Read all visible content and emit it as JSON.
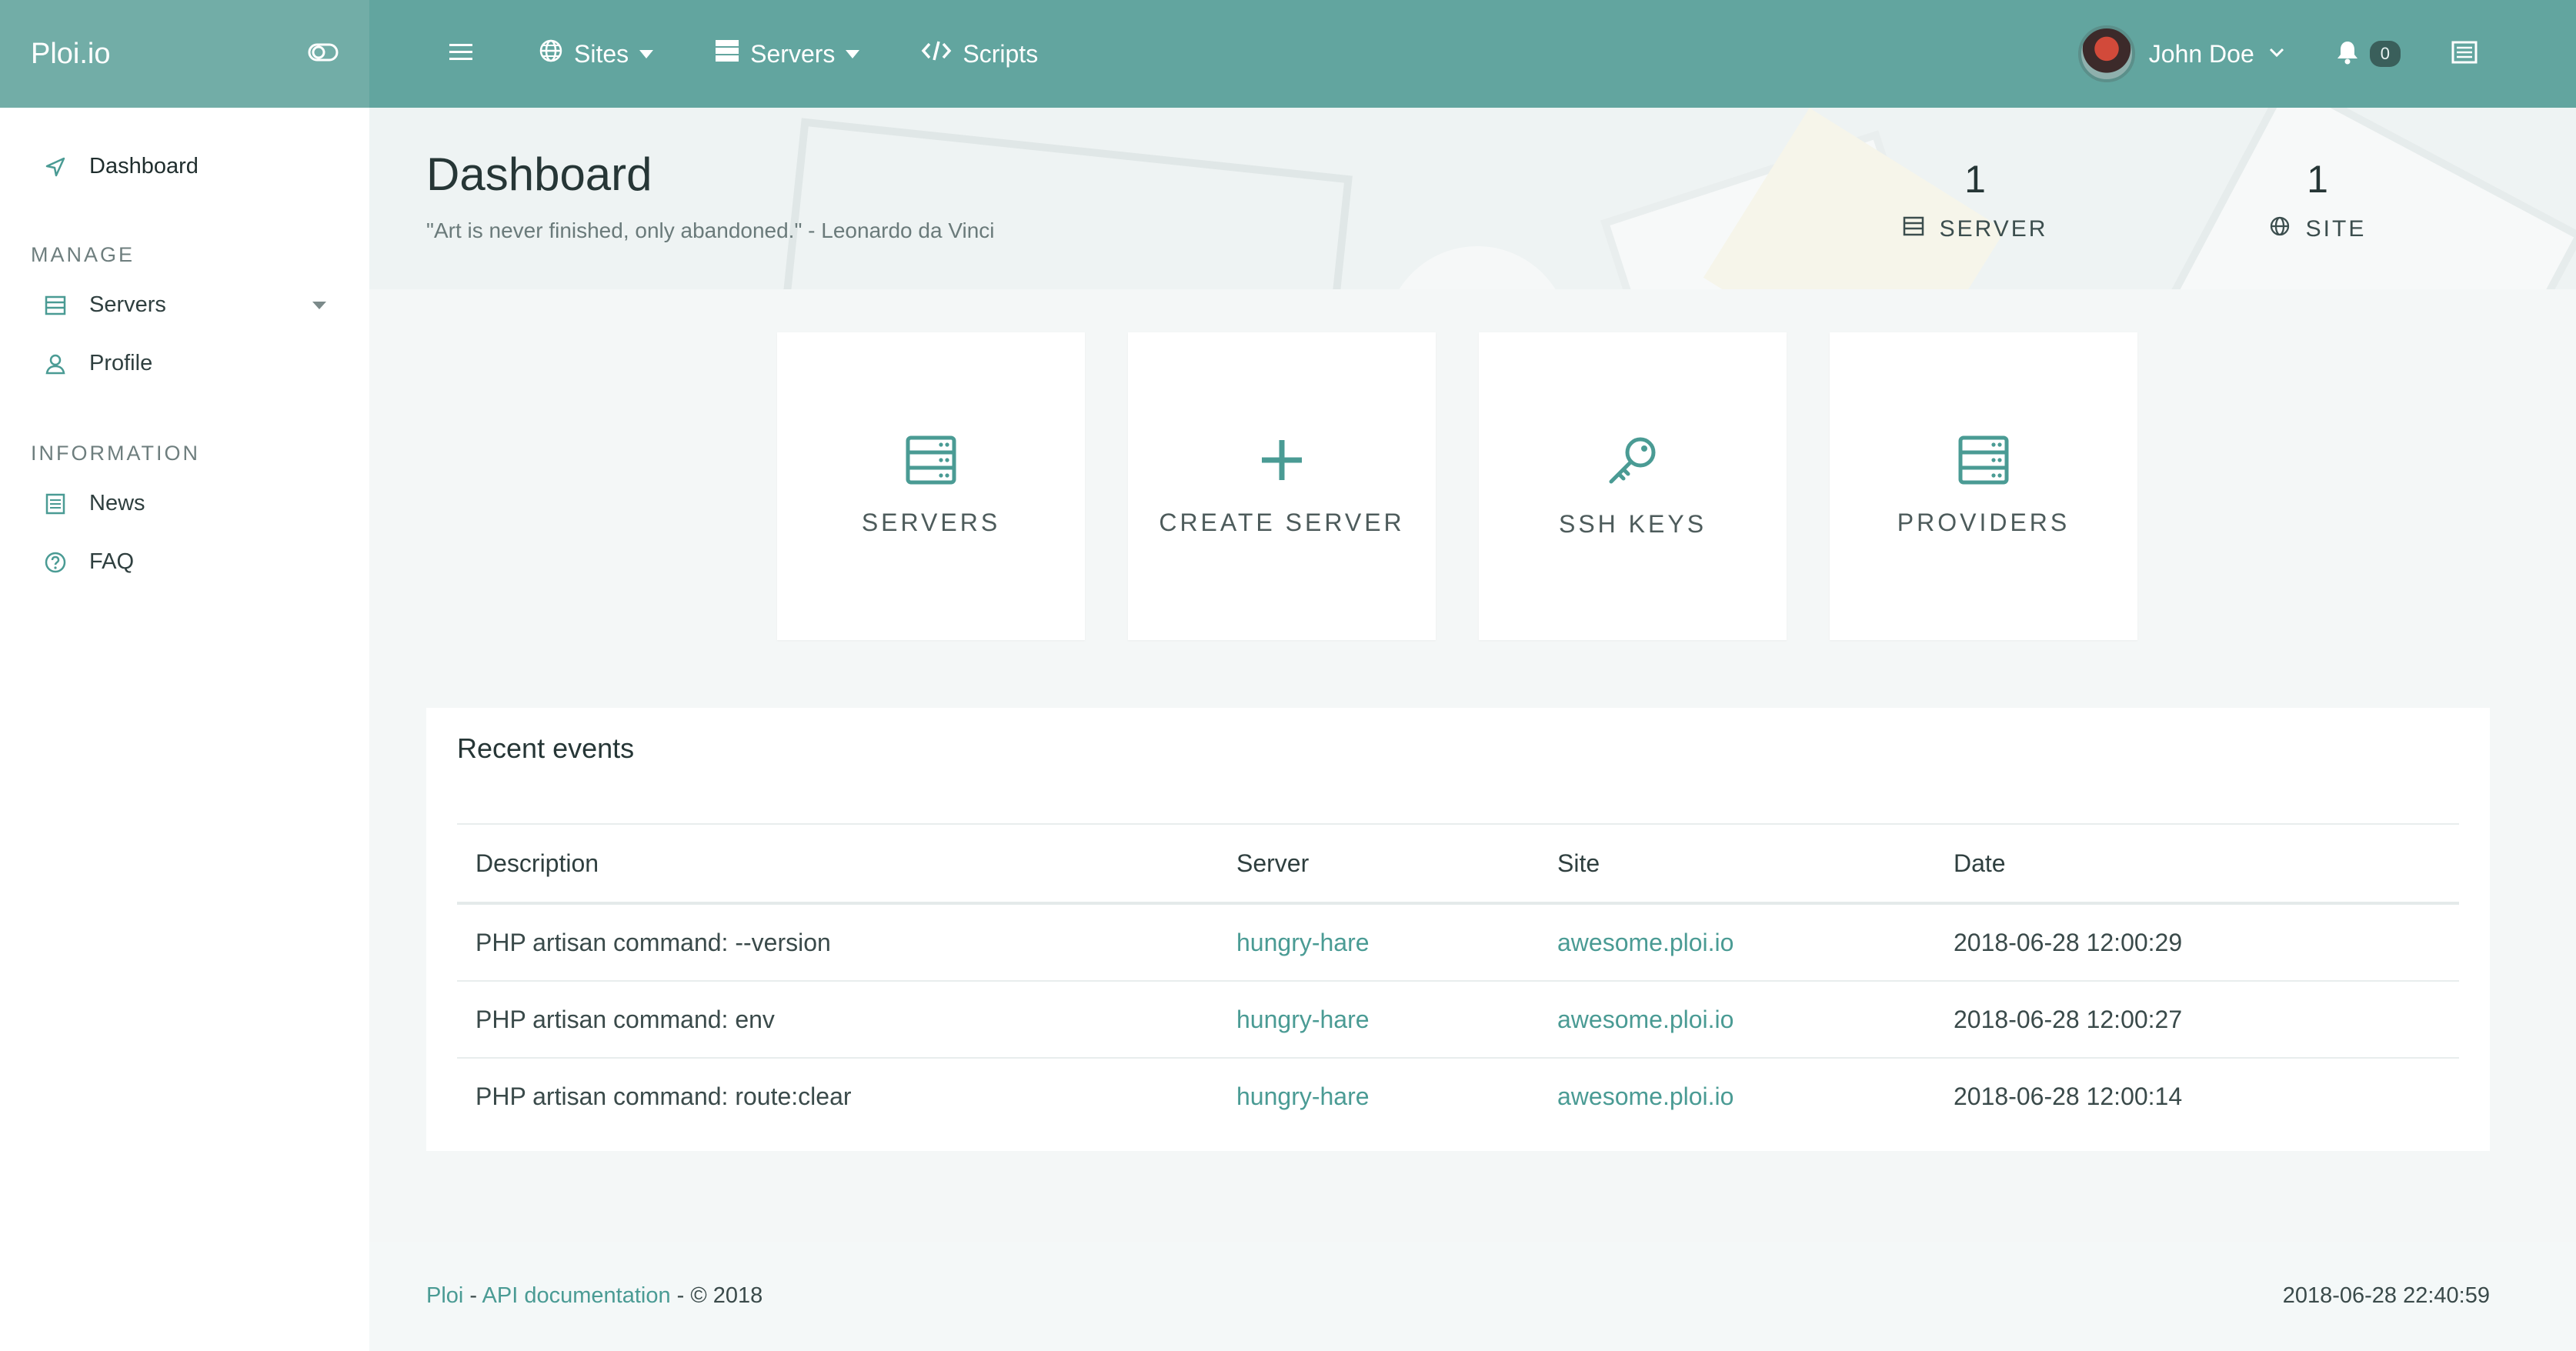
{
  "brand": {
    "name": "Ploi.io",
    "toggle_icon": "toggle-icon"
  },
  "topnav": {
    "menu_icon": "hamburger-icon",
    "items": [
      {
        "label": "Sites",
        "icon": "globe-icon"
      },
      {
        "label": "Servers",
        "icon": "server-icon"
      },
      {
        "label": "Scripts",
        "icon": "code-icon"
      }
    ],
    "user": {
      "name": "John Doe"
    },
    "notifications": {
      "count": "0"
    }
  },
  "sidebar": {
    "dashboard": "Dashboard",
    "manage_heading": "MANAGE",
    "servers": "Servers",
    "profile": "Profile",
    "information_heading": "INFORMATION",
    "news": "News",
    "faq": "FAQ"
  },
  "hero": {
    "title": "Dashboard",
    "quote": "\"Art is never finished, only abandoned.\" - Leonardo da Vinci",
    "stats": [
      {
        "value": "1",
        "label": "SERVER"
      },
      {
        "value": "1",
        "label": "SITE"
      }
    ]
  },
  "cards": [
    {
      "label": "SERVERS"
    },
    {
      "label": "CREATE SERVER"
    },
    {
      "label": "SSH KEYS"
    },
    {
      "label": "PROVIDERS"
    }
  ],
  "events": {
    "title": "Recent events",
    "columns": [
      "Description",
      "Server",
      "Site",
      "Date"
    ],
    "rows": [
      {
        "description": "PHP artisan command: --version",
        "server": "hungry-hare",
        "site": "awesome.ploi.io",
        "date": "2018-06-28 12:00:29"
      },
      {
        "description": "PHP artisan command: env",
        "server": "hungry-hare",
        "site": "awesome.ploi.io",
        "date": "2018-06-28 12:00:27"
      },
      {
        "description": "PHP artisan command: route:clear",
        "server": "hungry-hare",
        "site": "awesome.ploi.io",
        "date": "2018-06-28 12:00:14"
      }
    ]
  },
  "footer": {
    "brand_link": "Ploi",
    "sep1": " - ",
    "api_link": "API documentation",
    "copyright": " - © 2018",
    "timestamp": "2018-06-28 22:40:59"
  },
  "colors": {
    "accent": "#62a59f",
    "brand_bg": "#72ada7",
    "link": "#4a9b94"
  }
}
